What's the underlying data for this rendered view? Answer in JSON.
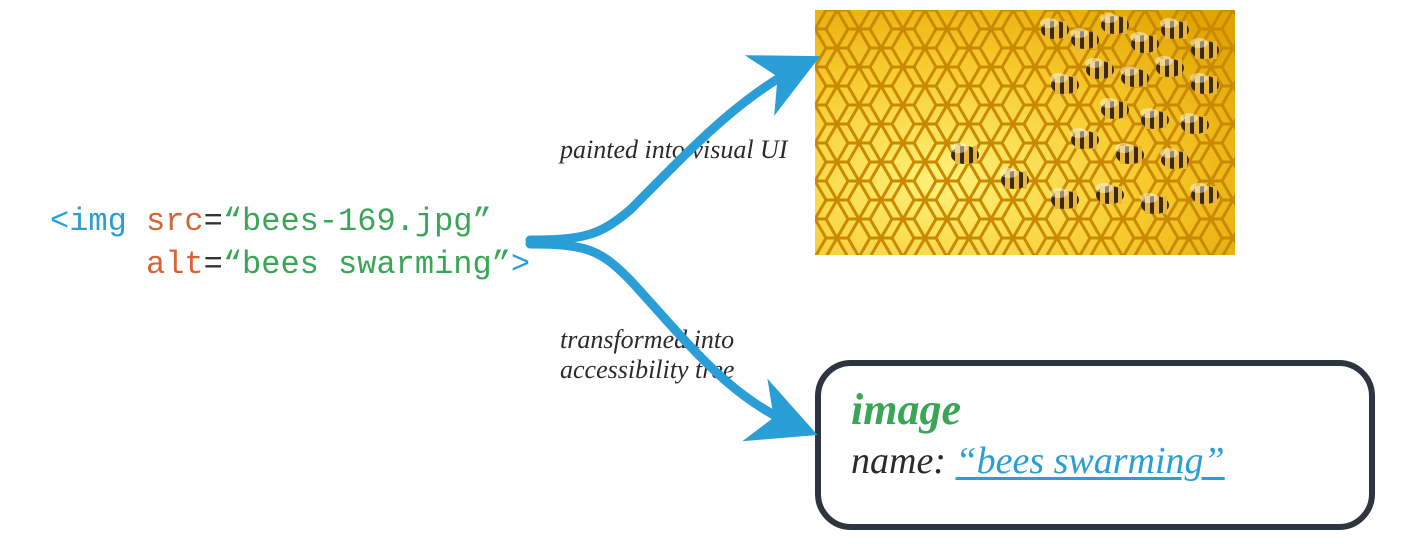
{
  "code": {
    "tag_open": "<",
    "tag_name": "img",
    "attr1_name": "src",
    "eq": "=",
    "quote_open": "“",
    "quote_close": "”",
    "attr1_value": "bees-169.jpg",
    "attr2_name": "alt",
    "attr2_value": "bees swarming",
    "tag_close": ">"
  },
  "annotations": {
    "top": "painted into visual UI",
    "bottom_line1": "transformed into",
    "bottom_line2": "accessibility tree"
  },
  "a11y": {
    "role": "image",
    "name_label": "name: ",
    "name_value_quoted": "“bees swarming”"
  }
}
